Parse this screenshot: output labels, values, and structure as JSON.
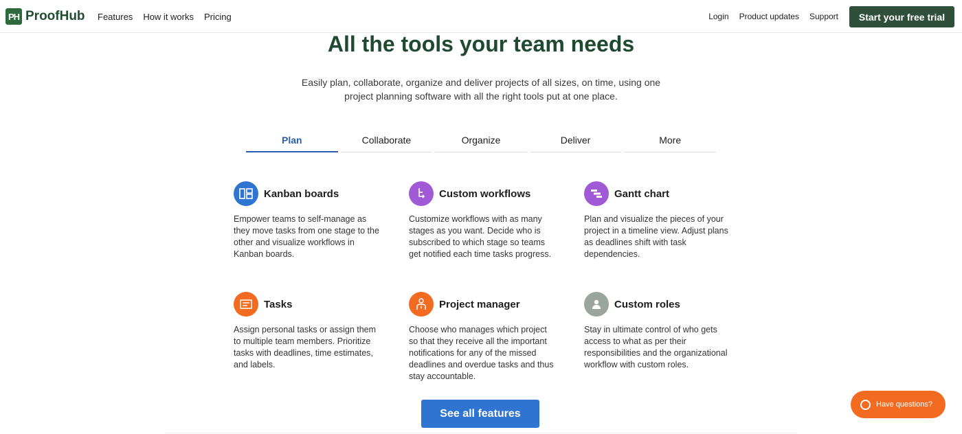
{
  "header": {
    "logo_badge": "PH",
    "logo_text": "ProofHub",
    "nav_left": [
      "Features",
      "How it works",
      "Pricing"
    ],
    "nav_right": [
      "Login",
      "Product updates",
      "Support"
    ],
    "cta_label": "Start your free trial"
  },
  "hero": {
    "title": "All the tools your team needs",
    "subtitle": "Easily plan, collaborate, organize and deliver projects of all sizes, on time, using one project planning software with all the right tools put at one place."
  },
  "tabs": [
    {
      "label": "Plan",
      "active": true
    },
    {
      "label": "Collaborate",
      "active": false
    },
    {
      "label": "Organize",
      "active": false
    },
    {
      "label": "Deliver",
      "active": false
    },
    {
      "label": "More",
      "active": false
    }
  ],
  "features": [
    {
      "title": "Kanban boards",
      "icon": "kanban-icon",
      "color": "#2f74d0",
      "desc": "Empower teams to self-manage as they move tasks from one stage to the other and visualize workflows in Kanban boards."
    },
    {
      "title": "Custom workflows",
      "icon": "workflow-icon",
      "color": "#a05ad6",
      "desc": "Customize workflows with as many stages as you want. Decide who is subscribed to which stage so teams get notified each time tasks progress."
    },
    {
      "title": "Gantt chart",
      "icon": "gantt-icon",
      "color": "#a05ad6",
      "desc": "Plan and visualize the pieces of your project in a timeline view. Adjust plans as deadlines shift with task dependencies."
    },
    {
      "title": "Tasks",
      "icon": "tasks-icon",
      "color": "#f26b21",
      "desc": "Assign personal tasks or assign them to multiple team members. Prioritize tasks with deadlines, time estimates, and labels."
    },
    {
      "title": "Project manager",
      "icon": "project-manager-icon",
      "color": "#f26b21",
      "desc": "Choose who manages which project so that they receive all the important notifications for any of the missed deadlines and overdue tasks and thus stay accountable."
    },
    {
      "title": "Custom roles",
      "icon": "custom-roles-icon",
      "color": "#9aa59b",
      "desc": "Stay in ultimate control of who gets access to what as per their responsibilities and the organizational workflow with custom roles."
    }
  ],
  "see_all_label": "See all features",
  "help_label": "Have questions?"
}
